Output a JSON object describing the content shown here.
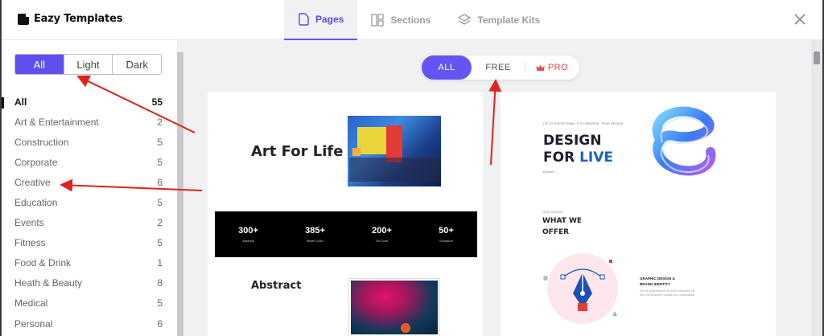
{
  "brand": {
    "name": "Eazy Templates"
  },
  "header": {
    "tabs": [
      {
        "label": "Pages",
        "icon": "page-icon",
        "active": true
      },
      {
        "label": "Sections",
        "icon": "sections-icon",
        "active": false
      },
      {
        "label": "Template Kits",
        "icon": "layers-icon",
        "active": false
      }
    ],
    "close_icon": "close-icon"
  },
  "sidebar": {
    "filters": [
      {
        "label": "All",
        "active": true
      },
      {
        "label": "Light",
        "active": false
      },
      {
        "label": "Dark",
        "active": false
      }
    ],
    "categories": [
      {
        "label": "All",
        "count": "55"
      },
      {
        "label": "Art & Entertainment",
        "count": "2"
      },
      {
        "label": "Construction",
        "count": "5"
      },
      {
        "label": "Corporate",
        "count": "5"
      },
      {
        "label": "Creative",
        "count": "6"
      },
      {
        "label": "Education",
        "count": "5"
      },
      {
        "label": "Events",
        "count": "2"
      },
      {
        "label": "Fitness",
        "count": "5"
      },
      {
        "label": "Food & Drink",
        "count": "1"
      },
      {
        "label": "Heath & Beauty",
        "count": "8"
      },
      {
        "label": "Medical",
        "count": "5"
      },
      {
        "label": "Personal",
        "count": "6"
      }
    ]
  },
  "pricing": {
    "all_label": "ALL",
    "free_label": "FREE",
    "pro_label": "PRO",
    "pro_icon": "crown-icon",
    "accent": "#6455f2",
    "pro_color": "#e5484d"
  },
  "templates": {
    "art": {
      "title": "Art For Life",
      "stats": [
        {
          "value": "300+",
          "label": "Abstract"
        },
        {
          "value": "385+",
          "label": "Water Color"
        },
        {
          "value": "200+",
          "label": "Oil Color"
        },
        {
          "value": "50+",
          "label": "Sculpture"
        }
      ],
      "section_title": "Abstract"
    },
    "design": {
      "kicker": "LIE TO EVERYTHING. IT'S CREATIVE. TRUE DESIGN",
      "title_line1": "DESIGN",
      "title_line2a": "FOR ",
      "title_line2b": "LIVE",
      "link": "Explore →",
      "small_label": "OUR DESIGN",
      "offer_line1": "WHAT WE",
      "offer_line2": "OFFER",
      "service_line1": "GRAPHIC DESIGN &",
      "service_line2": "BRAND IDENTITY",
      "service_text": "Far far away behind the word mountains, far from the countries Vokalia and Consonantia."
    }
  },
  "annotation_color": "#e0221b"
}
